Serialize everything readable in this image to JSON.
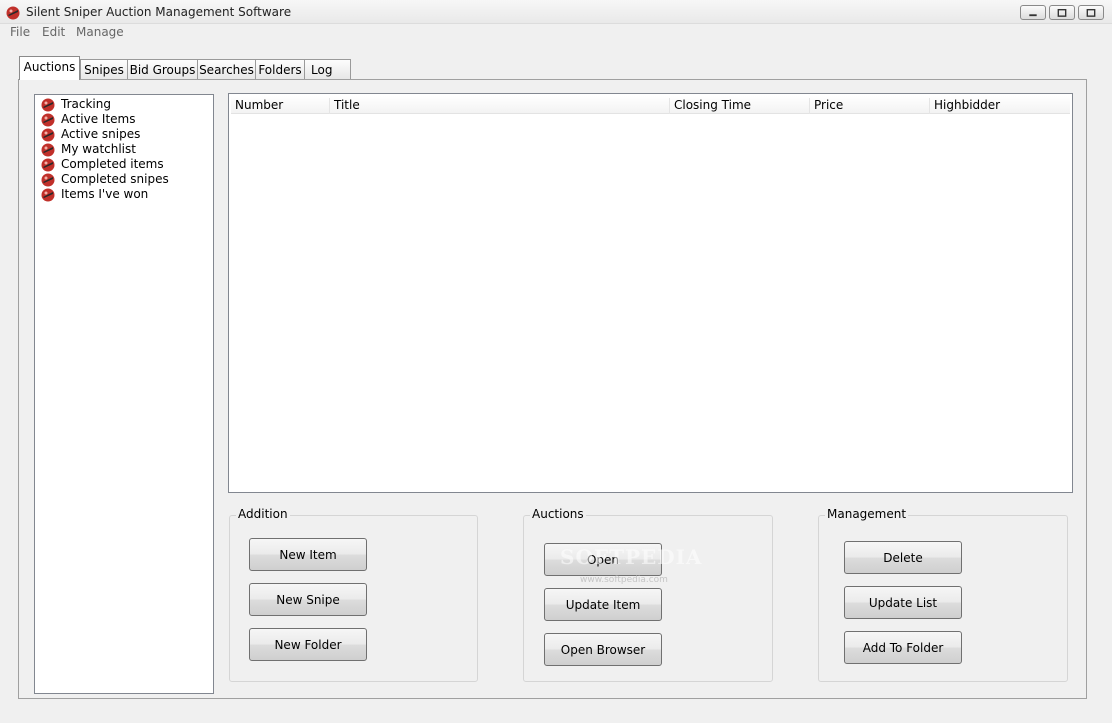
{
  "window": {
    "title": "Silent Sniper Auction Management Software",
    "controls": {
      "minimize": "minimize-icon",
      "maximize": "restore-icon",
      "close": "close-icon"
    },
    "icon": "sniper-logo-icon"
  },
  "menu": [
    "File",
    "Edit",
    "Manage"
  ],
  "tabs": [
    "Auctions",
    "Snipes",
    "Bid Groups",
    "Searches",
    "Folders",
    "Log"
  ],
  "active_tab": "Auctions",
  "tree": {
    "items": [
      "Tracking",
      "Active Items",
      "Active snipes",
      "My watchlist",
      "Completed items",
      "Completed snipes",
      "Items I've won"
    ],
    "item_icon": "sniper-logo-icon"
  },
  "list": {
    "columns": [
      "Number",
      "Title",
      "Closing Time",
      "Price",
      "Highbidder"
    ],
    "rows": []
  },
  "groups": {
    "addition": {
      "title": "Addition",
      "buttons": [
        "New Item",
        "New Snipe",
        "New Folder"
      ]
    },
    "auctions": {
      "title": "Auctions",
      "buttons": [
        "Open",
        "Update Item",
        "Open Browser"
      ]
    },
    "management": {
      "title": "Management",
      "buttons": [
        "Delete",
        "Update List",
        "Add To Folder"
      ]
    }
  },
  "watermark": {
    "text": "SOFTPEDIA",
    "sub": "www.softpedia.com"
  },
  "colors": {
    "icon_red": "#c0302a",
    "window_bg": "#f0f0f0",
    "border": "#828790"
  }
}
